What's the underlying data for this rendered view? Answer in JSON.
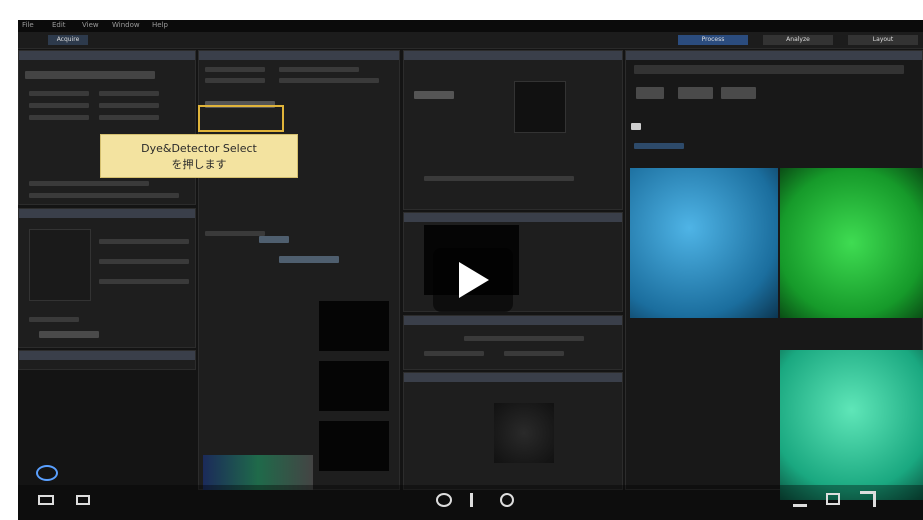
{
  "menu": [
    "File",
    "Edit",
    "View",
    "Window",
    "Help"
  ],
  "toolbar": {
    "tab1": "Acquire",
    "tab2": "Process",
    "tab3": "Analyze",
    "tab4": "Layout"
  },
  "callout": {
    "line1": "Dye&Detector Select",
    "line2": "を押します"
  },
  "player": {
    "play_icon": "play-icon",
    "volume_icon": "volume-icon",
    "captions_icon": "captions-icon",
    "settings_icon": "settings-icon",
    "fullscreen_icon": "fullscreen-icon"
  },
  "images": [
    {
      "name": "cyan-channel",
      "color": "#2f8fc4"
    },
    {
      "name": "green-channel",
      "color": "#1fae3a"
    },
    {
      "name": "teal-channel",
      "color": "#2fc08f"
    }
  ]
}
